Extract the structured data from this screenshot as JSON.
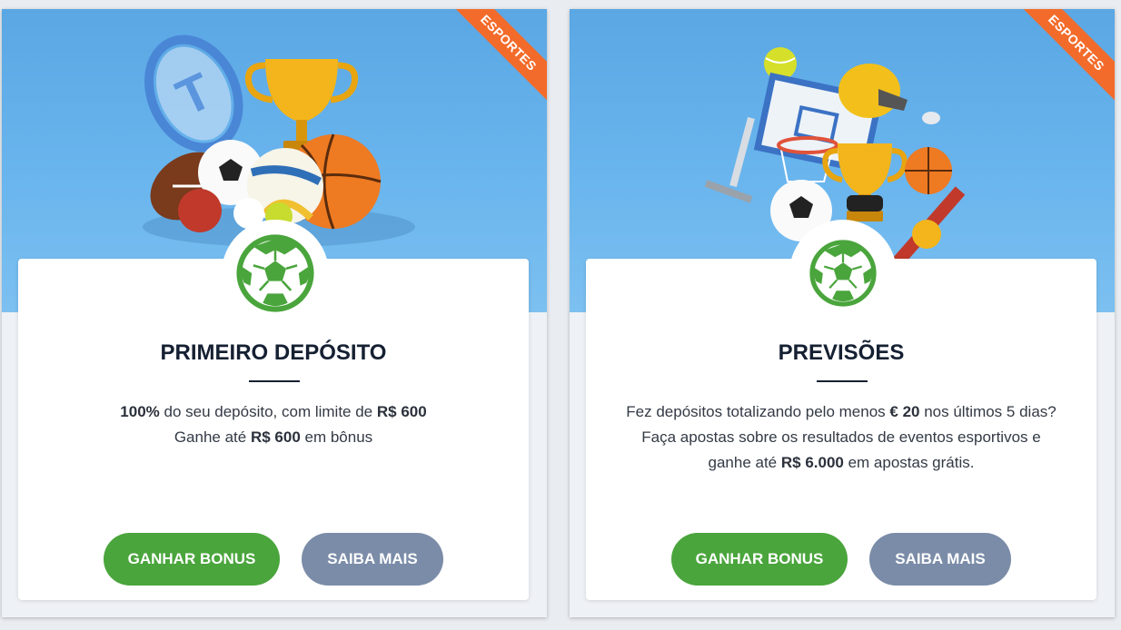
{
  "cards": [
    {
      "ribbon": "ESPORTES",
      "title": "PRIMEIRO DEPÓSITO",
      "lines": [
        [
          {
            "t": "100%",
            "b": true
          },
          {
            "t": " do seu depósito, com limite de ",
            "b": false
          },
          {
            "t": "R$ 600",
            "b": true
          }
        ],
        [
          {
            "t": "Ganhe até ",
            "b": false
          },
          {
            "t": "R$ 600",
            "b": true
          },
          {
            "t": " em bônus",
            "b": false
          }
        ]
      ],
      "primary_button": "GANHAR BONUS",
      "secondary_button": "SAIBA MAIS",
      "icon": "soccer-ball-icon",
      "hero_image": "sports-equipment-illustration"
    },
    {
      "ribbon": "ESPORTES",
      "title": "PREVISÕES",
      "lines": [
        [
          {
            "t": "Fez depósitos totalizando pelo menos ",
            "b": false
          },
          {
            "t": "€ 20",
            "b": true
          },
          {
            "t": " nos últimos 5 dias?",
            "b": false
          }
        ],
        [
          {
            "t": "Faça apostas sobre os resultados de eventos esportivos e",
            "b": false
          }
        ],
        [
          {
            "t": "ganhe até ",
            "b": false
          },
          {
            "t": "R$ 6.000",
            "b": true
          },
          {
            "t": " em apostas grátis.",
            "b": false
          }
        ]
      ],
      "primary_button": "GANHAR BONUS",
      "secondary_button": "SAIBA MAIS",
      "icon": "soccer-ball-icon",
      "hero_image": "trophy-basketball-illustration"
    }
  ],
  "colors": {
    "primary_green": "#4aa53c",
    "secondary_gray": "#7b8ca8",
    "ribbon_orange": "#f36b2a",
    "hero_blue": "#6bb6ee",
    "title_navy": "#152032"
  }
}
